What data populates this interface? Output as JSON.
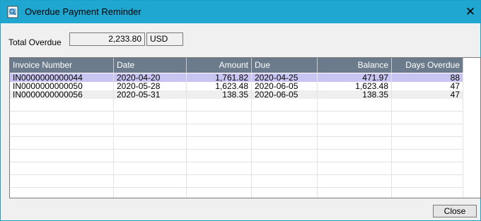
{
  "window": {
    "title": "Overdue Payment Reminder",
    "close_glyph": "✕",
    "icon": "app-report-icon"
  },
  "summary": {
    "total_label": "Total Overdue",
    "total_value": "2,233.80",
    "currency": "USD"
  },
  "table": {
    "columns": [
      "Invoice Number",
      "Date",
      "Amount",
      "Due",
      "Balance",
      "Days Overdue"
    ],
    "rows": [
      [
        "IN0000000000044",
        "2020-04-20",
        "1,761.82",
        "2020-04-25",
        "471.97",
        "88"
      ],
      [
        "IN0000000000050",
        "2020-05-28",
        "1,623.48",
        "2020-06-05",
        "1,623.48",
        "47"
      ],
      [
        "IN0000000000056",
        "2020-05-31",
        "138.35",
        "2020-06-05",
        "138.35",
        "47"
      ]
    ],
    "selected_row": 0
  },
  "buttons": {
    "close_label": "Close"
  }
}
